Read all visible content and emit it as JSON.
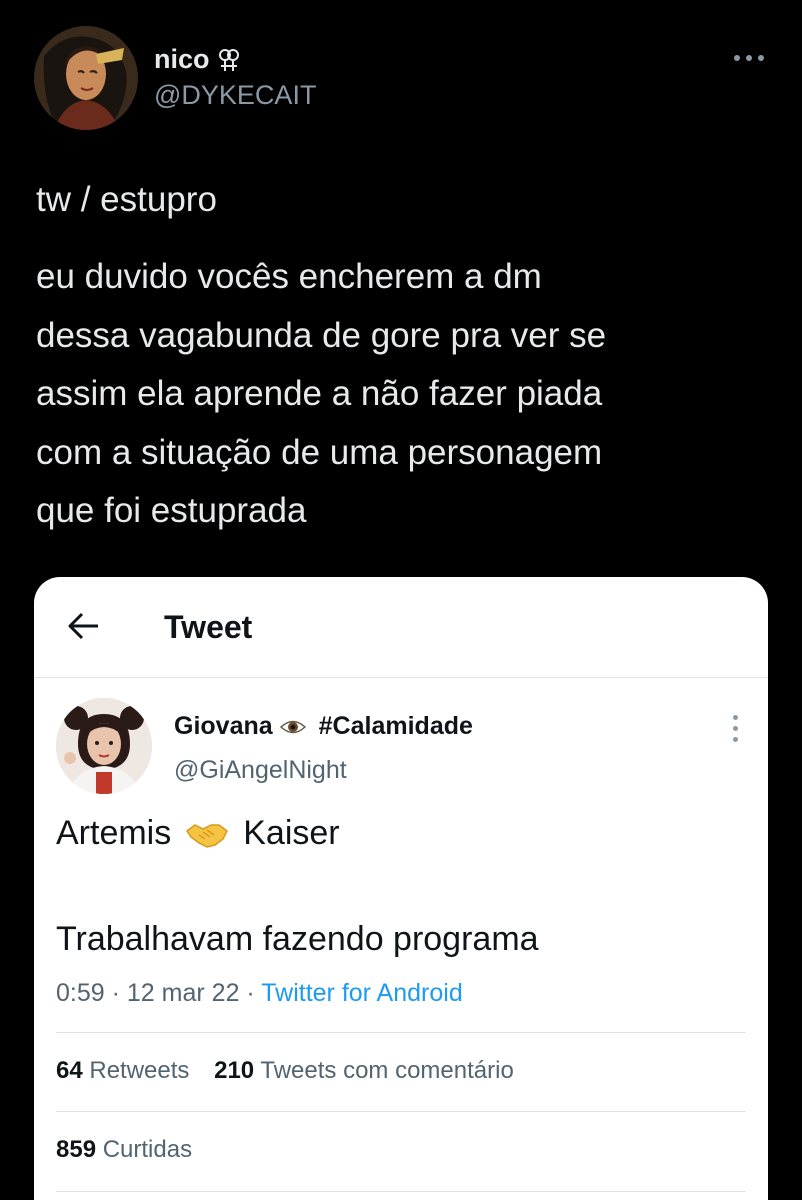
{
  "tweet": {
    "author": {
      "name": "nico",
      "handle": "@DYKECAIT",
      "icon": "lesbian-symbol-icon"
    },
    "more_icon": "more-horizontal-icon",
    "trigger_warning": "tw / estupro",
    "body_lines": [
      "eu duvido vocês encherem a dm",
      "dessa vagabunda de gore pra ver se",
      "assim ela aprende a não fazer piada",
      "com a situação de uma personagem",
      "que foi estuprada"
    ]
  },
  "embedded": {
    "header_title": "Tweet",
    "back_icon": "back-arrow-icon",
    "author": {
      "name": "Giovana",
      "tag": "#Calamidade",
      "handle": "@GiAngelNight",
      "icon": "eye-icon"
    },
    "line1": {
      "left": "Artemis",
      "emoji": "handshake-emoji",
      "right": "Kaiser"
    },
    "line2": "Trabalhavam fazendo programa",
    "meta": {
      "time": "0:59",
      "sep1": "·",
      "date": "12 mar 22",
      "sep2": "·",
      "source": "Twitter for Android"
    },
    "stats": {
      "retweets_count": "64",
      "retweets_label": "Retweets",
      "quotes_count": "210",
      "quotes_label": "Tweets com comentário",
      "likes_count": "859",
      "likes_label": "Curtidas"
    },
    "colors": {
      "link": "#1d9bf0",
      "secondary_text": "#536471"
    }
  }
}
